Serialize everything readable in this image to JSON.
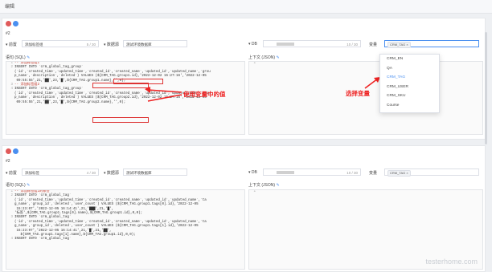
{
  "window": {
    "title": "编辑"
  },
  "sections": [
    {
      "index": "#2",
      "prefix_label": "前置",
      "name_value": "添加标签组",
      "name_count": "5 / 30",
      "db_label": "数据源",
      "db_value": "测试环境数据库",
      "sql_label": "语句 (SQL)",
      "ctx_label": "上下文 (JSON)",
      "var_label": "变量",
      "var_chip": "CRM_TAG",
      "lines": [
        "-- 添加标签组1",
        "INSERT INTO `crm_global_tag_group`",
        "(`id`,`created_time`,`updated_time`,`created_id`,`created_name`,`updated_id`,`updated_name`,`grou",
        "p_name`,`description`,`deleted`) VALUES (${CRM_TAG.group1.id},'2022-12-02 15:27:16','2022-12-05",
        " 09:55:55',21,'██',23,'█',${CRM_TAG.group1.name},'',0);",
        "-- 添加标签组2",
        "INSERT INTO `crm_global_tag_group`",
        "(`id`,`created_time`,`updated_time`,`created_id`,`created_name`,`updated_id`,`updated_name`,`grou",
        "p_name`,`description`,`deleted`) VALUES (${CRM_TAG.group2.id},'2022-12-02 15:27:16','2022-12-05",
        " 09:55:55',21,'██',23,'█',${CRM_TAG.group2.name},'',0);"
      ]
    },
    {
      "index": "#2",
      "prefix_label": "前置",
      "name_value": "添加标签",
      "name_count": "4 / 30",
      "db_label": "数据源",
      "db_value": "测试环境数据库",
      "sql_label": "语句 (SQL)",
      "ctx_label": "上下文 (JSON)",
      "var_label": "变量",
      "var_chip": "CRM_TAG",
      "lines": [
        "-- 添加标签组1的标签",
        "INSERT INTO `crm_global_tag`",
        "(`id`,`created_time`,`updated_time`,`created_id`,`created_name`,`updated_id`,`updated_name`,`ta",
        "g_name`,`group_id`,`deleted`,`user_count`) VALUES (${CRM_TAG.group1.tags[0].id},'2022-12-05",
        " 15:23:07','2022-12-05 16:14:41',21,'███',21,'█',",
        "'标签',${CRM_TAG.group1.tags[0].name},${CRM_TAG.group1.id},0,0);",
        "INSERT INTO `crm_global_tag`",
        "(`id`,`created_time`,`updated_time`,`created_id`,`created_name`,`updated_id`,`updated_name`,`ta",
        "g_name`,`group_id`,`deleted`,`user_count`) VALUES (${CRM_TAG.group1.tags[1].id},'2022-12-05",
        " 15:23:07','2022-12-05 16:14:41',21,'█',21,'██',",
        "   ${CRM_TAG.group1.tags[1].name},${CRM_TAG.group1.id},0,0);",
        "INSERT INTO `crm_global_tag`"
      ]
    }
  ],
  "dropdown": {
    "options": [
      "CRM_EN",
      "QA",
      "CRM_TAG",
      "CRM_USER",
      "CRM_SKU",
      "Course"
    ],
    "active": "CRM_TAG"
  },
  "annotations": {
    "use_var": "使用变量中的值",
    "select_var": "选择变量"
  },
  "watermark": "testerhome.com",
  "colors": {
    "accent": "#4a8ff0",
    "annotation": "#e22222",
    "delete": "#e05a5a"
  }
}
